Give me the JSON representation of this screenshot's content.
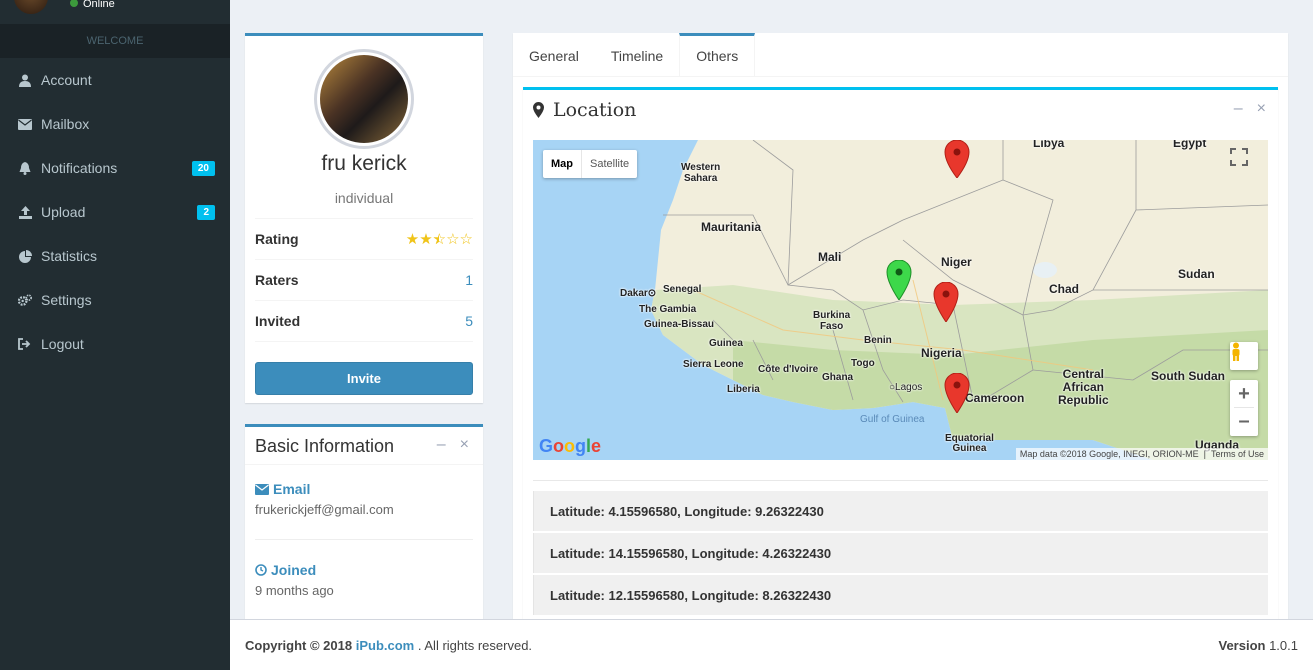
{
  "sidebar": {
    "status": "Online",
    "section_header": "WELCOME",
    "items": [
      {
        "label": "Account",
        "icon": "user-icon"
      },
      {
        "label": "Mailbox",
        "icon": "envelope-icon"
      },
      {
        "label": "Notifications",
        "icon": "bell-icon",
        "badge": "20"
      },
      {
        "label": "Upload",
        "icon": "upload-icon",
        "badge": "2"
      },
      {
        "label": "Statistics",
        "icon": "pie-chart-icon"
      },
      {
        "label": "Settings",
        "icon": "cogs-icon"
      },
      {
        "label": "Logout",
        "icon": "sign-out-icon"
      }
    ]
  },
  "profile": {
    "name": "fru kerick",
    "role": "individual",
    "rating_label": "Rating",
    "rating_value": 2.5,
    "raters_label": "Raters",
    "raters_value": "1",
    "invited_label": "Invited",
    "invited_value": "5",
    "invite_button": "Invite"
  },
  "basic_info": {
    "title": "Basic Information",
    "email_label": "Email",
    "email_value": "frukerickjeff@gmail.com",
    "joined_label": "Joined",
    "joined_value": "9 months ago"
  },
  "tabs": [
    "General",
    "Timeline",
    "Others"
  ],
  "location": {
    "title": "Location",
    "map_type_map": "Map",
    "map_type_satellite": "Satellite",
    "logo": "Google",
    "attribution": "Map data ©2018 Google, INEGI, ORION-ME",
    "terms": "Terms of Use",
    "labels": [
      "Western Sahara",
      "Libya",
      "Egypt",
      "Mauritania",
      "Mali",
      "Niger",
      "Chad",
      "Sudan",
      "Dakar",
      "Senegal",
      "The Gambia",
      "Guinea-Bissau",
      "Guinea",
      "Sierra Leone",
      "Liberia",
      "Côte d'Ivoire",
      "Ghana",
      "Togo",
      "Benin",
      "Burkina Faso",
      "Nigeria",
      "Lagos",
      "Cameroon",
      "Central African Republic",
      "South Sudan",
      "Gulf of Guinea",
      "Equatorial Guinea",
      "Uganda"
    ],
    "coordinates": [
      "Latitude: 4.15596580, Longitude: 9.26322430",
      "Latitude: 14.15596580, Longitude: 4.26322430",
      "Latitude: 12.15596580, Longitude: 8.26322430"
    ]
  },
  "footer": {
    "copyright_prefix": "Copyright © 2018",
    "site": "iPub.com",
    "rights": ". All rights reserved.",
    "version_label": "Version",
    "version": "1.0.1"
  }
}
